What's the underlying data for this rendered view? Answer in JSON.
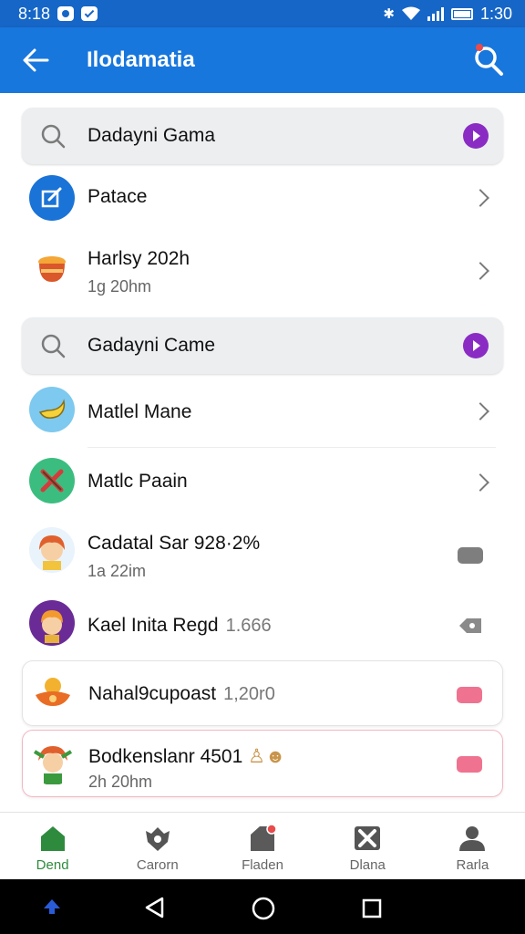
{
  "status_bar": {
    "time": "8:18",
    "clock": "1:30"
  },
  "app_bar": {
    "title": "Ilodamatia"
  },
  "colors": {
    "primary": "#1877dd",
    "status": "#1666c7",
    "accent_purple": "#8a2cc3",
    "nav_active": "#2e8b3e"
  },
  "search_bars": [
    {
      "text": "Dadayni Gama",
      "icon": "search-icon",
      "badge_icon": "play-badge-icon"
    },
    {
      "text": "Gadayni Came",
      "icon": "search-icon",
      "badge_icon": "play-badge-icon"
    }
  ],
  "list_items": [
    {
      "title": "Patace",
      "subtitle": "",
      "extra": "",
      "icon": "edit-square-icon",
      "trailing": "chevron-right-icon"
    },
    {
      "title": "Harlsy 202h",
      "subtitle": "1g 20hm",
      "extra": "",
      "icon": "pudding-icon",
      "trailing": "chevron-right-icon"
    },
    {
      "title": "Matlel Mane",
      "subtitle": "",
      "extra": "",
      "icon": "banana-icon",
      "trailing": "chevron-right-icon"
    },
    {
      "title": "Matlc Paain",
      "subtitle": "",
      "extra": "",
      "icon": "crossed-swords-icon",
      "trailing": "chevron-right-icon"
    },
    {
      "title": "Cadatal Sar 928·2%",
      "subtitle": "1a 22im",
      "extra": "",
      "icon": "girl-avatar-icon",
      "trailing": "gray-pill-icon"
    },
    {
      "title": "Kael Inita Regd",
      "subtitle": "",
      "extra": "1.666",
      "icon": "boy-avatar-icon",
      "trailing": "gray-tag-icon"
    },
    {
      "title": "Nahal9cupoast",
      "subtitle": "",
      "extra": "1,20r0",
      "icon": "lamp-icon",
      "trailing": "pink-pill-icon"
    },
    {
      "title": "Bodkenslanr 4501",
      "subtitle": "2h 20hm",
      "extra": "",
      "icon": "elf-avatar-icon",
      "trailing": "pink-pill-icon"
    }
  ],
  "bottom_nav": [
    {
      "label": "Dend",
      "icon": "home-icon",
      "active": true
    },
    {
      "label": "Carorn",
      "icon": "gamepad-icon",
      "active": false
    },
    {
      "label": "Fladen",
      "icon": "tag-icon",
      "active": false
    },
    {
      "label": "Dlana",
      "icon": "tools-icon",
      "active": false
    },
    {
      "label": "Rarla",
      "icon": "profile-icon",
      "active": false
    }
  ]
}
